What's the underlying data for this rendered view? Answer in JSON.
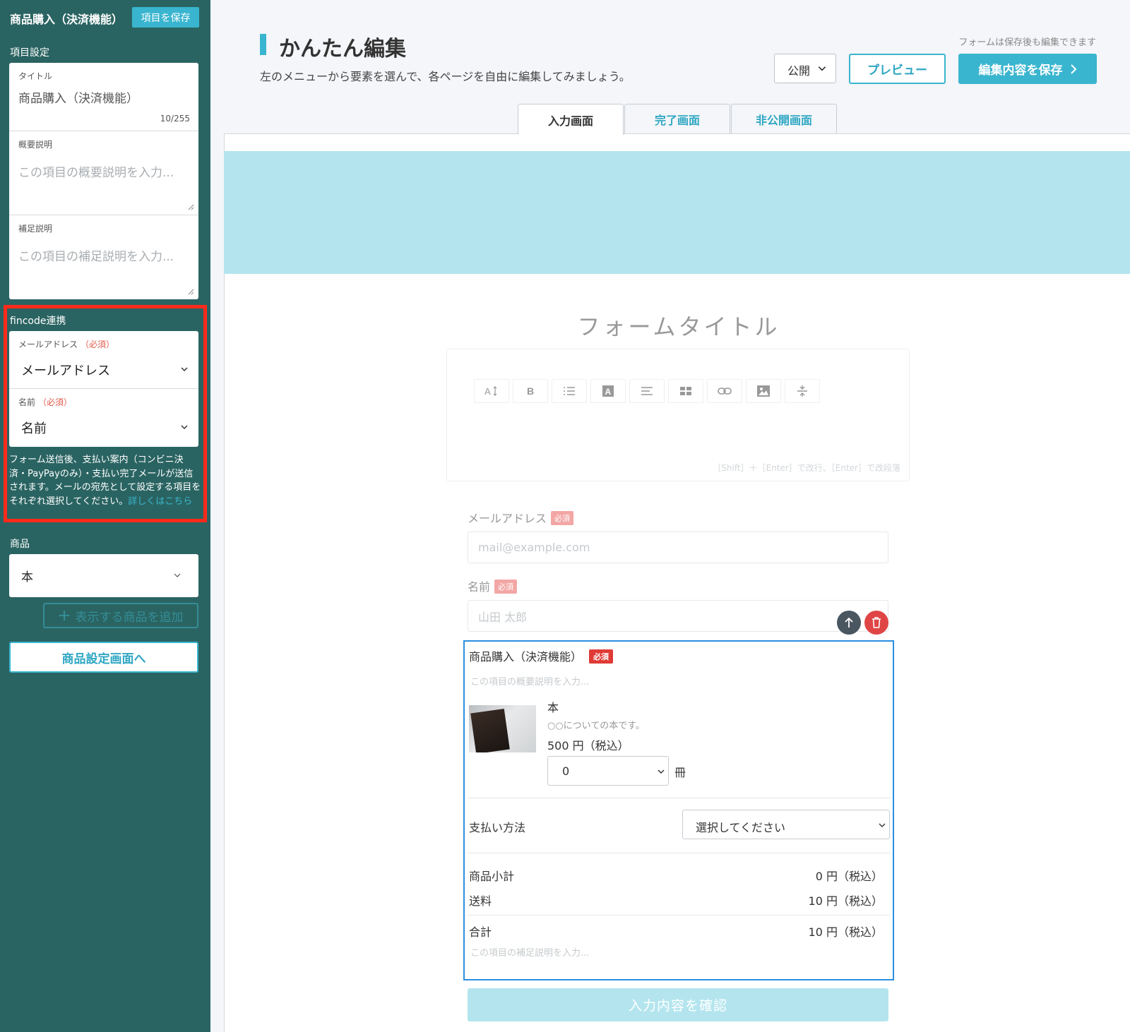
{
  "sidebar": {
    "title": "商品購入（決済機能）",
    "save_label": "項目を保存",
    "item_settings_heading": "項目設定",
    "title_field": {
      "label": "タイトル",
      "value": "商品購入（決済機能）",
      "count": "10/255"
    },
    "summary_field": {
      "label": "概要説明",
      "placeholder": "この項目の概要説明を入力..."
    },
    "supplement_field": {
      "label": "補足説明",
      "placeholder": "この項目の補足説明を入力..."
    },
    "fincode": {
      "heading": "fincode連携",
      "email": {
        "label": "メールアドレス",
        "required": "（必須）",
        "value": "メールアドレス"
      },
      "name": {
        "label": "名前",
        "required": "（必須）",
        "value": "名前"
      },
      "note": "フォーム送信後、支払い案内（コンビニ決済・PayPayのみ）・支払い完了メールが送信されます。メールの宛先として設定する項目をそれぞれ選択してください。",
      "note_link": "詳しくはこちら"
    },
    "product_heading": "商品",
    "product_value": "本",
    "add_product_label": "表示する商品を追加",
    "goto_product_label": "商品設定画面へ"
  },
  "header": {
    "title": "かんたん編集",
    "subtitle": "左のメニューから要素を選んで、各ページを自由に編集してみましょう。",
    "hint": "フォームは保存後も編集できます",
    "visibility": "公開",
    "preview_label": "プレビュー",
    "save_label": "編集内容を保存"
  },
  "tabs": [
    "入力画面",
    "完了画面",
    "非公開画面"
  ],
  "form": {
    "title": "フォームタイトル",
    "editor_hint": "［Shift］＋［Enter］で改行、［Enter］で改段落",
    "email_label": "メールアドレス",
    "email_placeholder": "mail@example.com",
    "name_label": "名前",
    "name_placeholder": "山田 太郎",
    "required_badge": "必須",
    "purchase": {
      "title": "商品購入（決済機能）",
      "required_badge": "必須",
      "summary_placeholder": "この項目の概要説明を入力...",
      "product_name": "本",
      "product_desc": "○○についての本です。",
      "product_price": "500 円（税込）",
      "quantity": "0",
      "unit": "冊",
      "payment_label": "支払い方法",
      "payment_placeholder": "選択してください",
      "subtotal_label": "商品小計",
      "subtotal_value": "0 円（税込）",
      "shipping_label": "送料",
      "shipping_value": "10 円（税込）",
      "total_label": "合計",
      "total_value": "10 円（税込）",
      "supplement_placeholder": "この項目の補足説明を入力..."
    },
    "confirm_label": "入力内容を確認"
  },
  "colors": {
    "sidebar_bg": "#2a6462",
    "accent": "#3ab5cf",
    "banner": "#b4e5ee",
    "highlight_border": "#ff2a1a",
    "selected_border": "#2b8ee0",
    "required": "#e03a36"
  }
}
